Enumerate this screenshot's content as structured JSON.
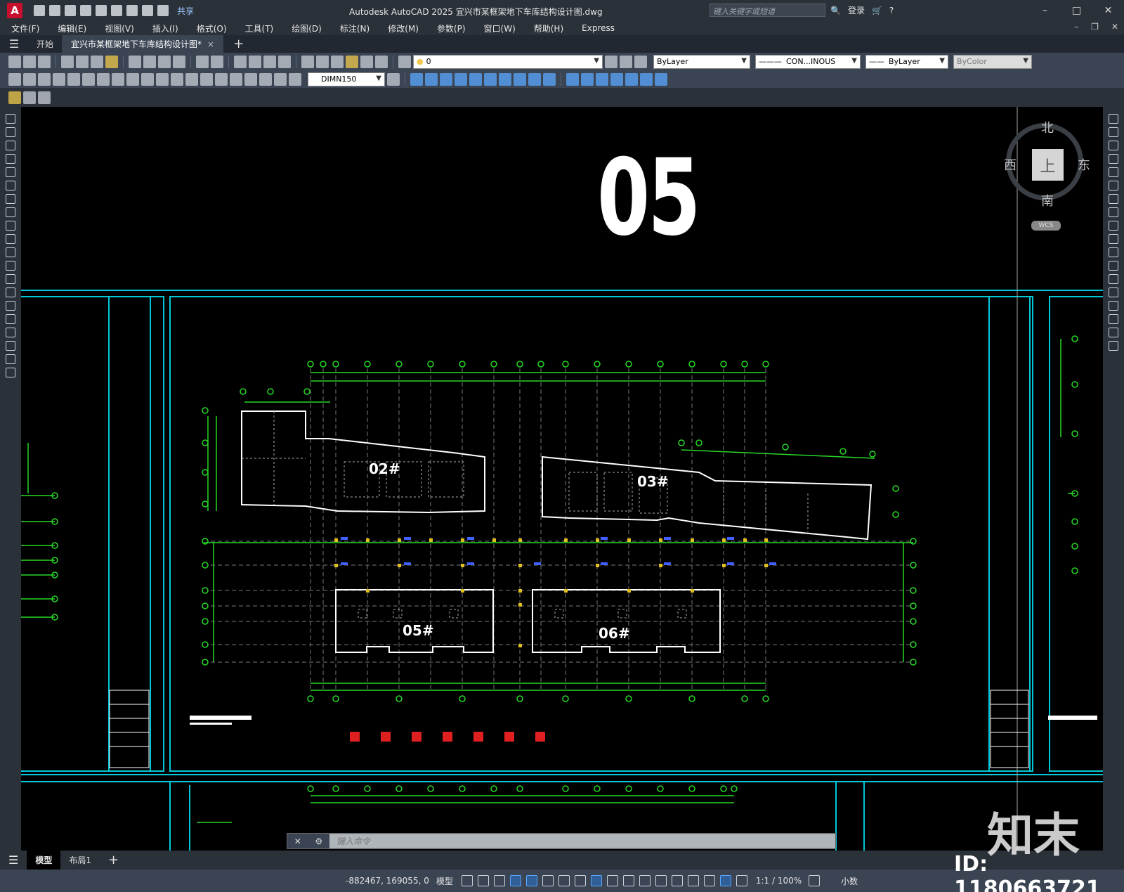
{
  "app": {
    "logo": "A",
    "title": "Autodesk AutoCAD 2025    宜兴市某框架地下车库结构设计图.dwg",
    "share_label": "共享",
    "search_placeholder": "键入关键字或短语",
    "login_label": "登录"
  },
  "menu": [
    "文件(F)",
    "编辑(E)",
    "视图(V)",
    "插入(I)",
    "格式(O)",
    "工具(T)",
    "绘图(D)",
    "标注(N)",
    "修改(M)",
    "参数(P)",
    "窗口(W)",
    "帮助(H)",
    "Express"
  ],
  "tabs": {
    "start": "开始",
    "doc": "宜兴市某框架地下车库结构设计图*",
    "close": "×",
    "add": "+"
  },
  "properties": {
    "layer": "0",
    "color": "ByLayer",
    "linetype": "CON...INOUS",
    "lineweight": "ByLayer",
    "plotstyle": "ByColor",
    "dimstyle": "DIMN150"
  },
  "viewcube": {
    "north": "北",
    "south": "南",
    "east": "东",
    "west": "西",
    "top": "上",
    "wcs": "WCS"
  },
  "drawing": {
    "sheet_number": "05",
    "buildings": [
      "02#",
      "03#",
      "05#",
      "06#"
    ]
  },
  "command": {
    "placeholder": "键入命令"
  },
  "layouts": [
    "模型",
    "布局1"
  ],
  "status": {
    "coords": "-882467, 169055, 0",
    "model": "模型",
    "scale": "1:1 / 100%",
    "units": "小数"
  },
  "watermark": {
    "id": "ID: 1180663721",
    "logo": "知末"
  }
}
